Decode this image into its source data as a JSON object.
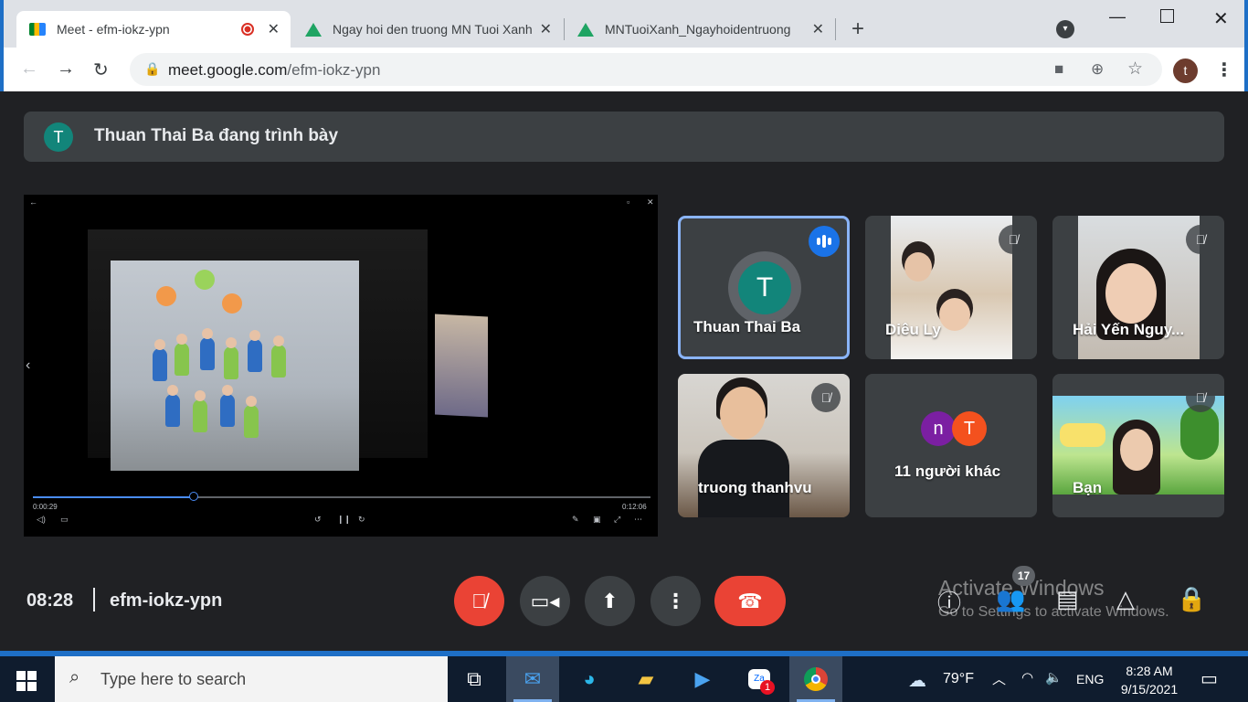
{
  "browser": {
    "tabs": [
      {
        "title": "Meet - efm-iokz-ypn",
        "active": true
      },
      {
        "title": "Ngay hoi den truong MN Tuoi Xanh",
        "active": false
      },
      {
        "title": "MNTuoiXanh_Ngayhoidentruong",
        "active": false
      }
    ],
    "new_tab": "+",
    "url_host": "meet.google.com",
    "url_path": "/efm-iokz-ypn",
    "profile_initial": "t"
  },
  "meet": {
    "presenter_initial": "T",
    "presenting_text": "Thuan Thai Ba đang trình bày",
    "video": {
      "elapsed": "0:00:29",
      "duration": "0:12:06",
      "progress": 0.26
    },
    "participants": [
      {
        "name": "Thuan Thai Ba",
        "initial": "T",
        "speaking": true,
        "muted": false
      },
      {
        "name": "Diêu Ly",
        "muted": true
      },
      {
        "name": "Hải Yến Nguy...",
        "muted": true
      },
      {
        "name": "truong thanhvu",
        "muted": true
      },
      {
        "name": "11 người khác",
        "initials": [
          "n",
          "T"
        ]
      },
      {
        "name": "Bạn",
        "muted": true
      }
    ],
    "clock": "08:28",
    "meeting_code": "efm-iokz-ypn",
    "people_count": "17",
    "watermark_title": "Activate Windows",
    "watermark_sub": "Go to Settings to activate Windows."
  },
  "taskbar": {
    "search_placeholder": "Type here to search",
    "zalo_badge": "1",
    "weather": "79°F",
    "language": "ENG",
    "time": "8:28 AM",
    "date": "9/15/2021"
  },
  "colors": {
    "meet_bg": "#202124",
    "tile_bg": "#3c4043",
    "red": "#ea4335",
    "speaking_border": "#8ab4f8",
    "teal_avatar": "#12857a"
  }
}
